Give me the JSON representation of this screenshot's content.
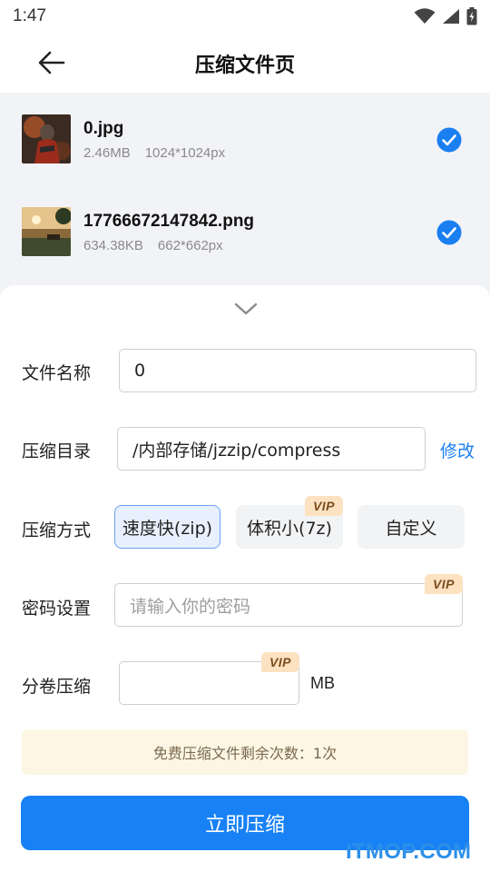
{
  "status_bar": {
    "time": "1:47",
    "icons": [
      "wifi-icon",
      "signal-icon",
      "battery-icon"
    ]
  },
  "header": {
    "title": "压缩文件页",
    "back_icon": "arrow-left-icon"
  },
  "files": [
    {
      "name": "0.jpg",
      "size": "2.46MB",
      "dimensions": "1024*1024px",
      "selected": true
    },
    {
      "name": "17766672147842.png",
      "size": "634.38KB",
      "dimensions": "662*662px",
      "selected": true
    }
  ],
  "form": {
    "filename": {
      "label": "文件名称",
      "value": "0"
    },
    "directory": {
      "label": "压缩目录",
      "value": "/内部存储/jzzip/compress",
      "action": "修改"
    },
    "method": {
      "label": "压缩方式",
      "options": [
        {
          "label": "速度快(zip)",
          "selected": true,
          "vip": false
        },
        {
          "label": "体积小(7z)",
          "selected": false,
          "vip": true
        },
        {
          "label": "自定义",
          "selected": false,
          "vip": false
        }
      ]
    },
    "password": {
      "label": "密码设置",
      "placeholder": "请输入你的密码",
      "vip": true
    },
    "split": {
      "label": "分卷压缩",
      "value": "",
      "unit": "MB",
      "vip": true
    },
    "vip_badge": "VIP"
  },
  "notice": "免费压缩文件剩余次数：1次",
  "submit_label": "立即压缩",
  "watermark": "ITMOP.COM",
  "colors": {
    "accent": "#1781f5",
    "check": "#1a7ff0",
    "link": "#1a7ff0",
    "vip_badge_bg": "#fde2c2",
    "notice_bg": "#fdf6e4"
  }
}
